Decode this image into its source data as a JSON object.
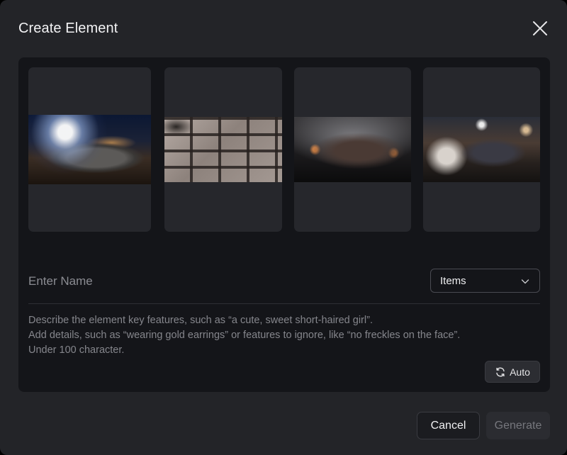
{
  "dialog": {
    "title": "Create Element",
    "close_icon": "close-icon"
  },
  "thumbnails": [
    {
      "alt": "race car with headlights at night crowd"
    },
    {
      "alt": "grid of car photos"
    },
    {
      "alt": "car drifting in smoke"
    },
    {
      "alt": "car among scooters at night"
    }
  ],
  "form": {
    "name_placeholder": "Enter Name",
    "name_value": "",
    "category_selected": "Items",
    "description_lines": [
      "Describe the element key features, such as “a cute, sweet short-haired girl”.",
      "Add details, such as “wearing gold earrings” or features to ignore, like “no freckles on the face”.",
      "Under 100 character."
    ],
    "auto_label": "Auto"
  },
  "footer": {
    "cancel_label": "Cancel",
    "generate_label": "Generate"
  },
  "colors": {
    "dialog_bg": "#232428",
    "panel_bg": "#141519",
    "thumb_bg": "#26272c",
    "text_primary": "#f2f2f4",
    "text_muted": "#85868c"
  }
}
